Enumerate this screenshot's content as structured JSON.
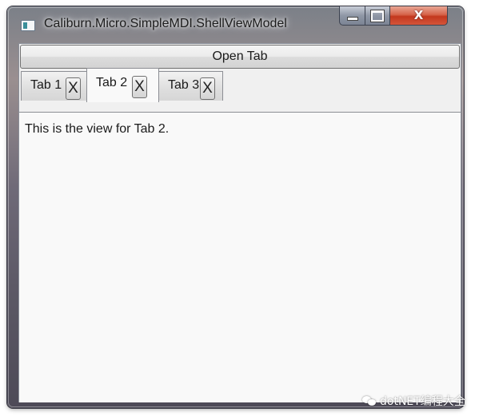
{
  "window": {
    "title": "Caliburn.Micro.SimpleMDI.ShellViewModel",
    "controls": {
      "minimize": "minimize",
      "maximize": "maximize",
      "close": "X"
    }
  },
  "toolbar": {
    "open_tab_label": "Open Tab"
  },
  "tabs": [
    {
      "label": "Tab 1",
      "close_label": "X",
      "selected": false
    },
    {
      "label": "Tab 2",
      "close_label": "X",
      "selected": true
    },
    {
      "label": "Tab 3",
      "close_label": "X",
      "selected": false
    }
  ],
  "content": {
    "text": "This is the view for Tab 2."
  },
  "watermark": {
    "text": "dotNET编程大全",
    "icon": "wechat-icon"
  },
  "colors": {
    "close_button": "#c3381e",
    "panel_bg": "#f9f9f9",
    "chrome": "#6f6a78"
  }
}
